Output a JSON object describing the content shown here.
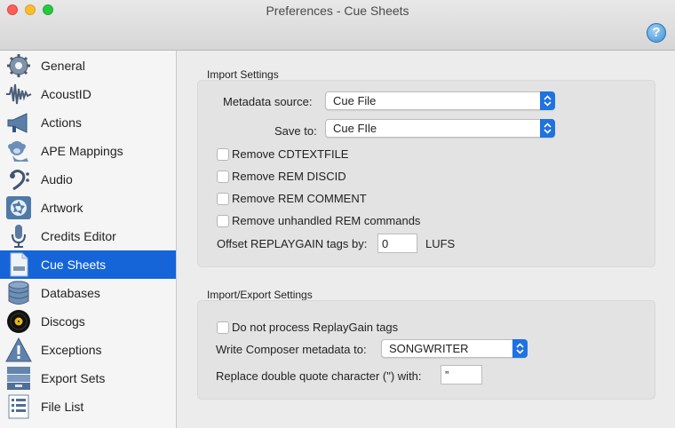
{
  "window": {
    "title": "Preferences - Cue Sheets"
  },
  "sidebar": {
    "items": [
      {
        "label": "General",
        "icon": "gear-icon"
      },
      {
        "label": "AcoustID",
        "icon": "waveform-icon"
      },
      {
        "label": "Actions",
        "icon": "megaphone-icon"
      },
      {
        "label": "APE Mappings",
        "icon": "monkey-icon"
      },
      {
        "label": "Audio",
        "icon": "bass-clef-icon"
      },
      {
        "label": "Artwork",
        "icon": "aperture-icon"
      },
      {
        "label": "Credits Editor",
        "icon": "microphone-icon"
      },
      {
        "label": "Cue Sheets",
        "icon": "cue-file-icon"
      },
      {
        "label": "Databases",
        "icon": "database-icon"
      },
      {
        "label": "Discogs",
        "icon": "vinyl-record-icon"
      },
      {
        "label": "Exceptions",
        "icon": "warning-icon"
      },
      {
        "label": "Export Sets",
        "icon": "export-tray-icon"
      },
      {
        "label": "File List",
        "icon": "list-icon"
      }
    ],
    "selected": "Cue Sheets"
  },
  "import_settings": {
    "title": "Import Settings",
    "metadata_source_label": "Metadata source:",
    "metadata_source_value": "Cue File",
    "save_to_label": "Save to:",
    "save_to_value": "Cue FIle",
    "checkboxes": [
      {
        "label": "Remove CDTEXTFILE",
        "checked": false
      },
      {
        "label": "Remove REM DISCID",
        "checked": false
      },
      {
        "label": "Remove REM COMMENT",
        "checked": false
      },
      {
        "label": "Remove unhandled REM commands",
        "checked": false
      }
    ],
    "offset_label": "Offset REPLAYGAIN tags by:",
    "offset_value": "0",
    "offset_unit": "LUFS"
  },
  "import_export_settings": {
    "title": "Import/Export Settings",
    "replaygain_label": "Do not process ReplayGain tags",
    "replaygain_checked": false,
    "composer_label": "Write Composer metadata to:",
    "composer_value": "SONGWRITER",
    "quote_label": "Replace double quote character (\") with:",
    "quote_value": "”"
  },
  "colors": {
    "selection": "#1565d8",
    "popup_arrow": "#1f72e0"
  }
}
